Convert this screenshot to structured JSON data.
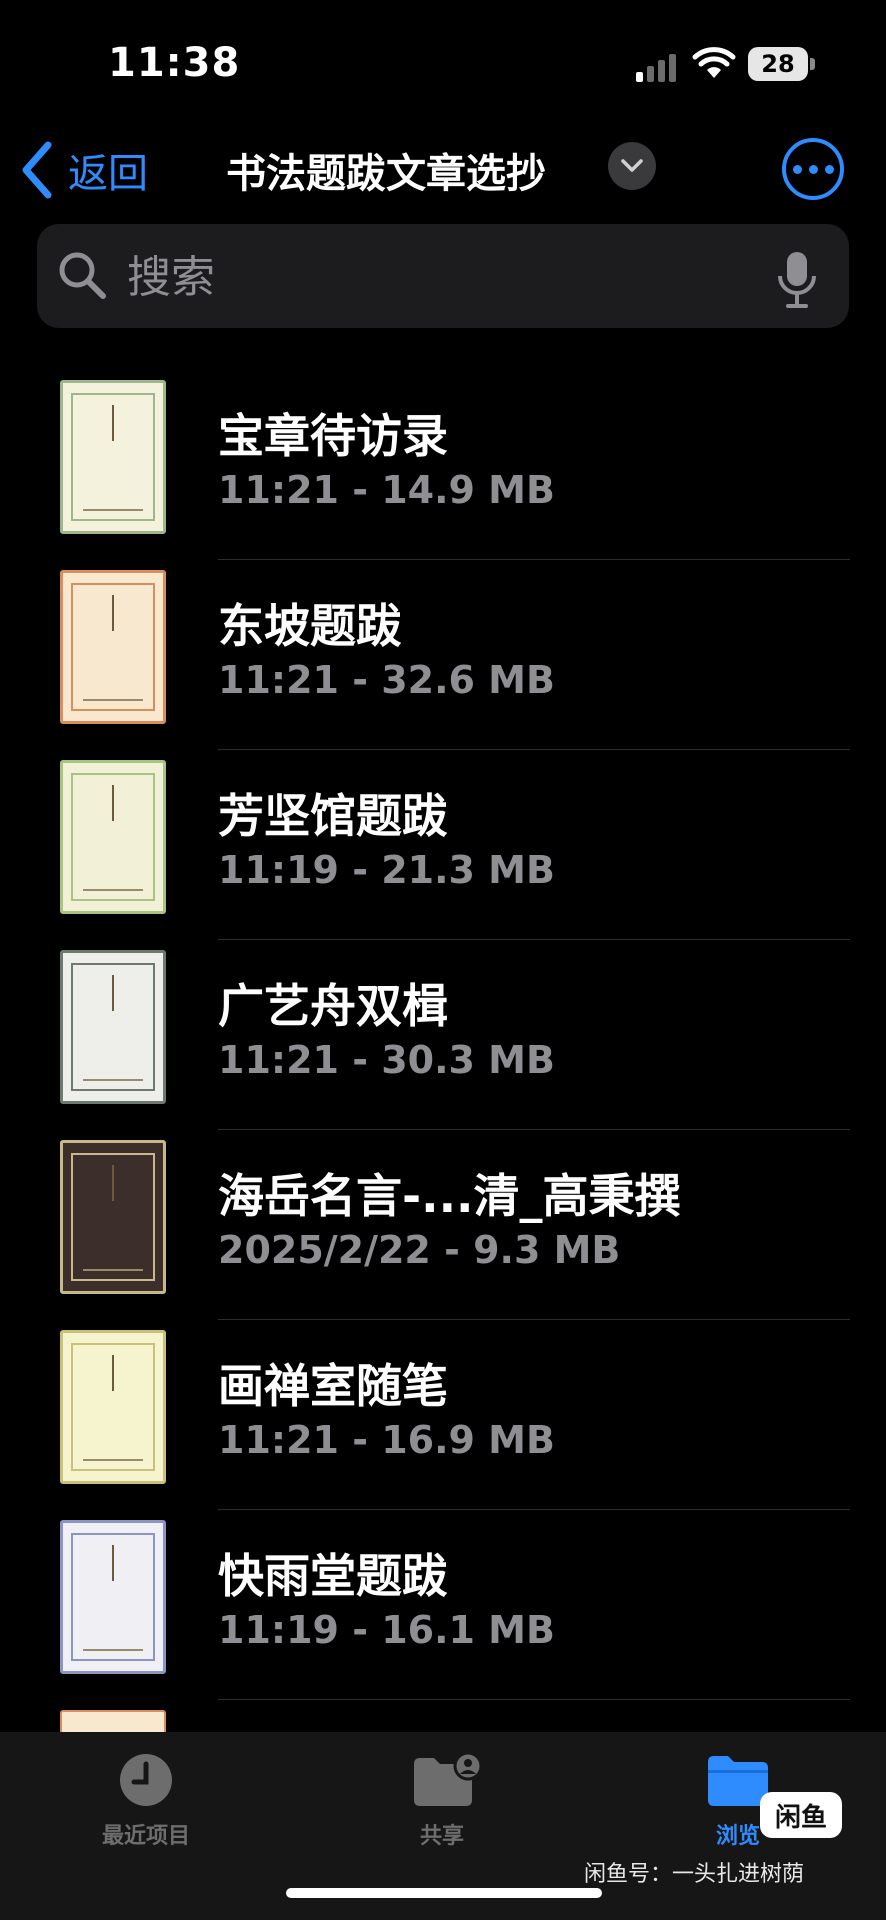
{
  "status_bar": {
    "time": "11:38",
    "battery": "28"
  },
  "nav": {
    "back_label": "返回",
    "title": "书法题跋文章选抄"
  },
  "search": {
    "placeholder": "搜索"
  },
  "files": [
    {
      "name": "宝章待访录",
      "meta": "11:21 - 14.9 MB",
      "cover": {
        "bg": "#f4f1dc",
        "border": "#9fb58a"
      }
    },
    {
      "name": "东坡题跋",
      "meta": "11:21 - 32.6 MB",
      "cover": {
        "bg": "#f7e8cf",
        "border": "#d98e5e"
      }
    },
    {
      "name": "芳坚馆题跋",
      "meta": "11:19 - 21.3 MB",
      "cover": {
        "bg": "#f2f1d8",
        "border": "#a9c481"
      }
    },
    {
      "name": "广艺舟双楫",
      "meta": "11:21 - 30.3 MB",
      "cover": {
        "bg": "#eeeeea",
        "border": "#6c7a70"
      }
    },
    {
      "name": "海岳名言-...清_高秉撰",
      "meta": "2025/2/22 - 9.3 MB",
      "cover": {
        "bg": "#3c2f2b",
        "border": "#c9b98a"
      }
    },
    {
      "name": "画禅室随笔",
      "meta": "11:21 - 16.9 MB",
      "cover": {
        "bg": "#f6f3cf",
        "border": "#c9c07a"
      }
    },
    {
      "name": "快雨堂题跋",
      "meta": "11:19 - 16.1 MB",
      "cover": {
        "bg": "#f0f0f4",
        "border": "#8a95c4"
      }
    }
  ],
  "tabs": [
    {
      "label": "最近项目",
      "icon": "clock-icon"
    },
    {
      "label": "共享",
      "icon": "shared-folder-icon"
    },
    {
      "label": "浏览",
      "icon": "folder-icon",
      "selected": true
    }
  ],
  "watermark": {
    "badge": "闲鱼",
    "text": "闲鱼号：一头扎进树荫"
  },
  "colors": {
    "accent": "#2f8cff",
    "background": "#000000",
    "secondary_text": "#8e8e93"
  }
}
